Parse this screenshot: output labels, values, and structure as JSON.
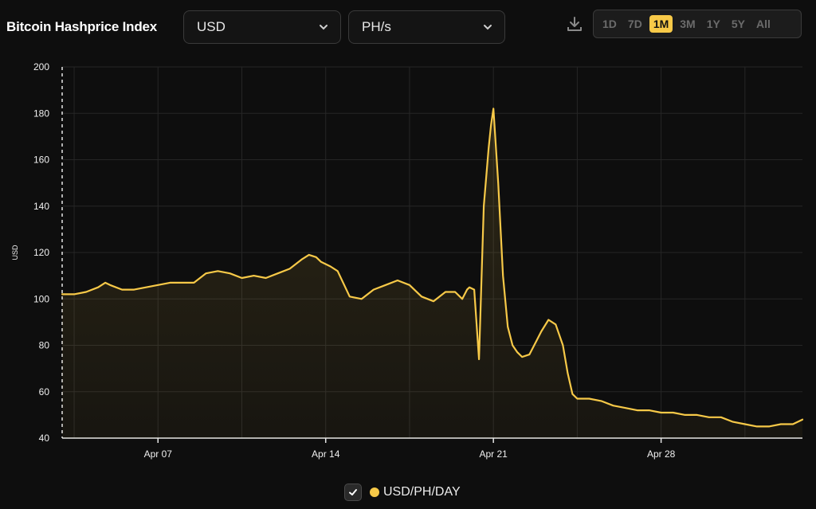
{
  "header": {
    "title": "Bitcoin Hashprice Index",
    "currency_select": "USD",
    "unit_select": "PH/s",
    "download_icon": "download-icon",
    "ranges": [
      "1D",
      "7D",
      "1M",
      "3M",
      "1Y",
      "5Y",
      "All"
    ],
    "active_range": "1M"
  },
  "colors": {
    "background": "#0e0e0e",
    "line": "#f7c948",
    "grid": "#262626",
    "axis": "#e6e6e6"
  },
  "legend": {
    "checkbox_icon": "check-icon",
    "label": "USD/PH/DAY",
    "checked": true
  },
  "chart_data": {
    "type": "area",
    "ylabel": "USD",
    "ylim": [
      40,
      200
    ],
    "yticks": [
      40,
      60,
      80,
      100,
      120,
      140,
      160,
      180,
      200
    ],
    "xlim_day": [
      3.0,
      5.3
    ],
    "xlim_note_unused": "",
    "xticks": [
      {
        "label": "Apr 07",
        "day": 7
      },
      {
        "label": "Apr 14",
        "day": 14
      },
      {
        "label": "Apr 21",
        "day": 21
      },
      {
        "label": "Apr 28",
        "day": 28
      }
    ],
    "x_days": [
      3.0,
      3.5,
      4.0,
      4.5,
      4.8,
      5.0,
      5.5,
      6.0,
      6.5,
      7.0,
      7.5,
      8.0,
      8.5,
      9.0,
      9.5,
      10.0,
      10.5,
      11.0,
      11.5,
      12.0,
      12.5,
      13.0,
      13.3,
      13.6,
      13.8,
      14.2,
      14.5,
      15.0,
      15.5,
      16.0,
      16.5,
      17.0,
      17.5,
      18.0,
      18.5,
      19.0,
      19.4,
      19.7,
      19.9,
      20.0,
      20.2,
      20.4,
      20.6,
      20.8,
      20.9,
      21.0,
      21.2,
      21.4,
      21.6,
      21.8,
      22.0,
      22.2,
      22.5,
      22.8,
      23.0,
      23.3,
      23.6,
      23.9,
      24.1,
      24.3,
      24.5,
      24.7,
      25.0,
      25.5,
      26.0,
      26.5,
      27.0,
      27.5,
      28.0,
      28.5,
      29.0,
      29.5,
      30.0,
      30.5,
      31.0,
      31.5,
      32.0,
      32.5,
      33.0,
      33.5,
      33.9
    ],
    "values": [
      102,
      102,
      103,
      105,
      107,
      106,
      104,
      104,
      105,
      106,
      107,
      107,
      107,
      111,
      112,
      111,
      109,
      110,
      109,
      111,
      113,
      117,
      119,
      118,
      116,
      114,
      112,
      101,
      100,
      104,
      106,
      108,
      106,
      101,
      99,
      103,
      103,
      100,
      104,
      105,
      104,
      74,
      140,
      165,
      175,
      182,
      150,
      110,
      88,
      80,
      77,
      75,
      76,
      82,
      86,
      91,
      89,
      80,
      68,
      59,
      57,
      57,
      57,
      56,
      54,
      53,
      52,
      52,
      51,
      51,
      50,
      50,
      49,
      49,
      47,
      46,
      45,
      45,
      46,
      46,
      48
    ]
  }
}
